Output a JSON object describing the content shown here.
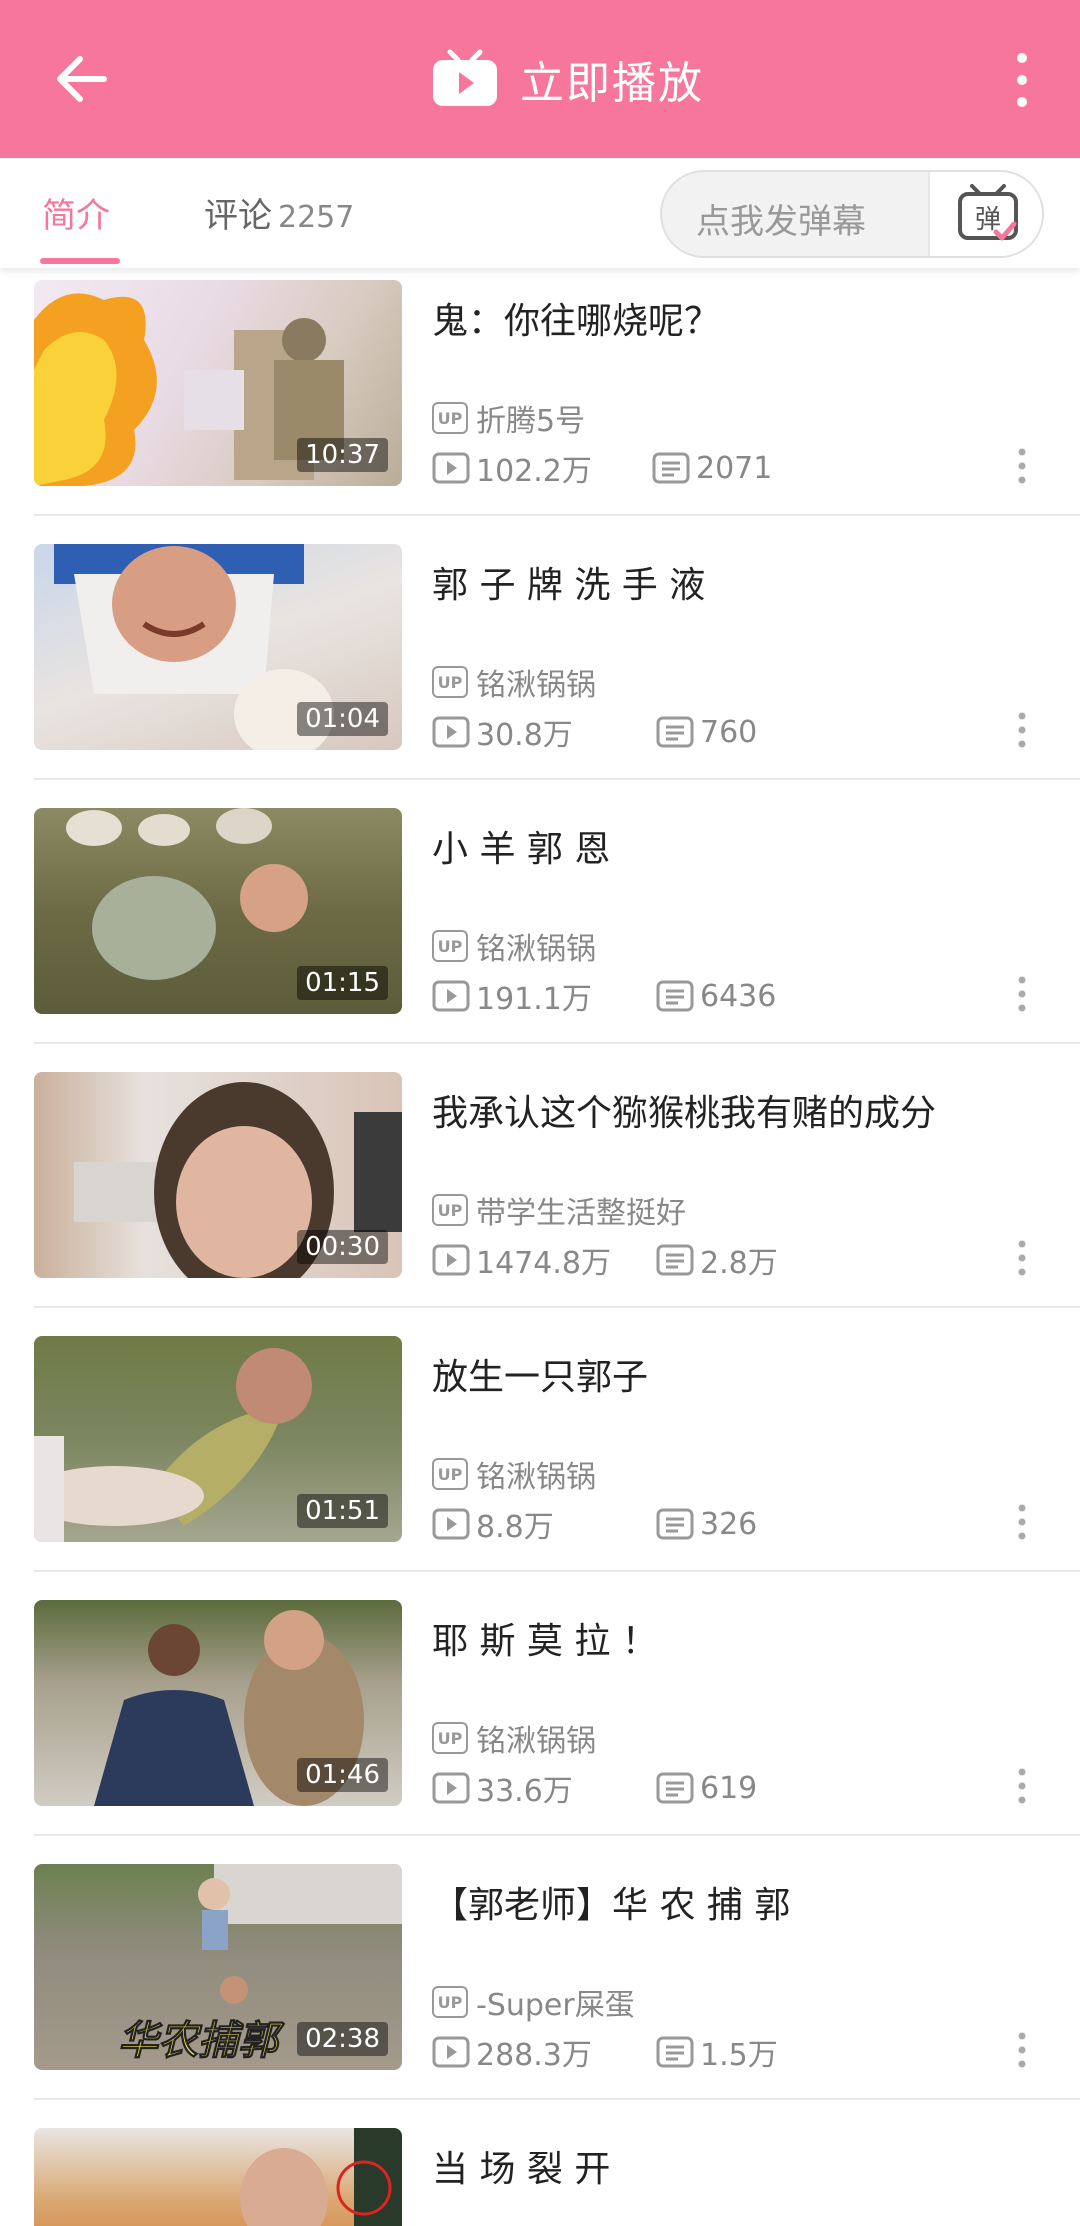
{
  "header": {
    "title": "立即播放",
    "back_icon": "back-arrow-icon",
    "tv_icon": "tv-icon",
    "more_icon": "more-vertical-icon",
    "bg_color": "#f7779c"
  },
  "tabs": {
    "intro": "简介",
    "comments": "评论",
    "comments_count": "2257",
    "active_color": "#f7779c"
  },
  "danmaku": {
    "placeholder": "点我发弹幕",
    "button_label": "弹"
  },
  "videos": [
    {
      "title": "鬼：你往哪烧呢？",
      "uploader": "折腾5号",
      "views": "102.2万",
      "danmaku": "2071",
      "duration": "10:37"
    },
    {
      "title": "郭 子 牌 洗 手 液",
      "uploader": "铭湫锅锅",
      "views": "30.8万",
      "danmaku": "760",
      "duration": "01:04"
    },
    {
      "title": "小 羊 郭 恩",
      "uploader": "铭湫锅锅",
      "views": "191.1万",
      "danmaku": "6436",
      "duration": "01:15"
    },
    {
      "title": "我承认这个猕猴桃我有赌的成分",
      "uploader": "带学生活整挺好",
      "views": "1474.8万",
      "danmaku": "2.8万",
      "duration": "00:30"
    },
    {
      "title": "放生一只郭子",
      "uploader": "铭湫锅锅",
      "views": "8.8万",
      "danmaku": "326",
      "duration": "01:51"
    },
    {
      "title": "耶 斯 莫 拉 ！",
      "uploader": "铭湫锅锅",
      "views": "33.6万",
      "danmaku": "619",
      "duration": "01:46"
    },
    {
      "title": "【郭老师】华 农 捕 郭",
      "uploader": "-Super屎蛋",
      "views": "288.3万",
      "danmaku": "1.5万",
      "duration": "02:38",
      "thumb_caption": "华农捕郭"
    },
    {
      "title": "当 场 裂 开",
      "uploader": "",
      "views": "",
      "danmaku": "",
      "duration": ""
    }
  ]
}
